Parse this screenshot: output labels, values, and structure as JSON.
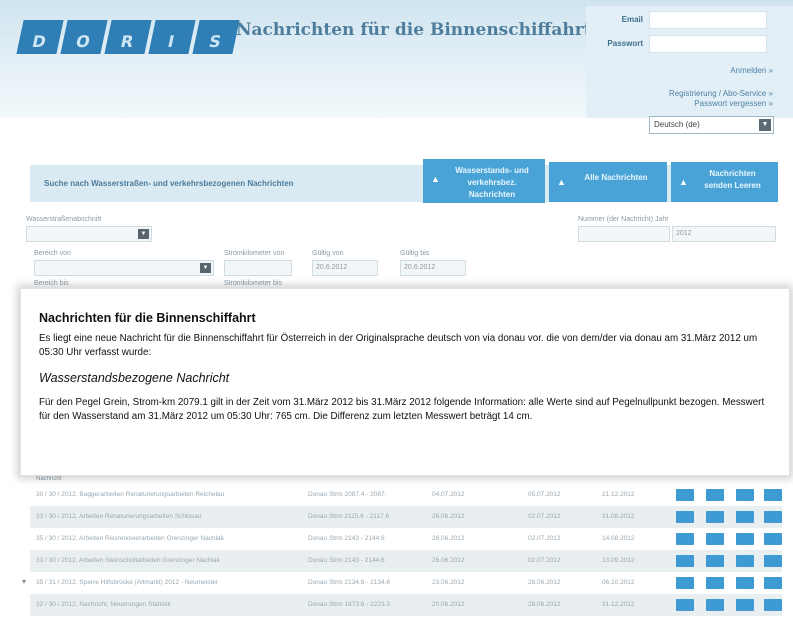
{
  "header": {
    "logo_letters": [
      "D",
      "O",
      "R",
      "I",
      "S"
    ],
    "title": "Nachrichten für die Binnenschiffahrt",
    "login": {
      "email_label": "Email",
      "password_label": "Passwort",
      "links": [
        "Anmelden",
        "Registrierung / Abo-Service",
        "Passwort vergessen"
      ]
    },
    "language": "Deutsch (de)"
  },
  "tabs": {
    "search_title": "Suche nach Wasserstraßen- und verkehrsbezogenen Nachrichten",
    "items": [
      {
        "label": "Wasserstands- und verkehrsbez. Nachrichten"
      },
      {
        "label": "Alle Nachrichten"
      },
      {
        "label": "Nachrichten senden Leeren"
      }
    ]
  },
  "form": {
    "waterway_label": "Wasserstraßenabschnitt",
    "range_from_label": "Bereich von",
    "range_to_label": "Bereich bis",
    "km_from_label": "Stromkilometer von",
    "km_to_label": "Stromkilometer bis",
    "valid_from_label": "Gültig von",
    "valid_to_label": "Gültig bis",
    "valid_from_value": "20.6.2012",
    "valid_to_value": "20.6.2012",
    "number_year_label": "Nummer (der Nachricht) Jahr",
    "year_value": "2012"
  },
  "overlay": {
    "title": "Nachrichten für die Binnenschiffahrt",
    "intro": "Es liegt eine neue Nachricht für die Binnenschiffahrt für Österreich in der Originalsprache deutsch von via donau vor. die von dem/der via donau am 31.März 2012 um 05:30 Uhr verfasst wurde:",
    "subtitle": "Wasserstandsbezogene Nachricht",
    "body": "Für den Pegel Grein, Strom-km 2079.1 gilt in der Zeit vom 31.März 2012 bis 31.März 2012 folgende Information: alle Werte sind auf Pegelnullpunkt bezogen. Messwert für den Wasserstand am 31.März 2012 um 05:30 Uhr: 765 cm. Die Differenz zum letzten Messwert beträgt 14 cm."
  },
  "results": {
    "header_label": "Nachricht",
    "rows": [
      {
        "title": "30 / 30 / 2012, Baggerarbeiten Renaturierungsarbeiten Reichelau",
        "km": "Donau Strm 2087.4 - 2087.",
        "from": "04.07.2012",
        "to": "05.07.2012",
        "date": "21.12.2012"
      },
      {
        "title": "33 / 30 / 2012, Arbeiten Renaturierungsarbeiten Schlosau",
        "km": "Donau Strm 2115.6 - 2117.6",
        "from": "26.06.2012",
        "to": "02.07.2012",
        "date": "31.08.2012"
      },
      {
        "title": "35 / 30 / 2012, Arbeiten Rissrenovierarbeiten Grenzinger Nachlak",
        "km": "Donau Strm 2143 - 2144.6",
        "from": "26.06.2012",
        "to": "02.07.2012",
        "date": "14.08.2012"
      },
      {
        "title": "33 / 30 / 2012, Arbeiten Steinschüttarbeiten Grenzinger Nachlak",
        "km": "Donau Strm 2143 - 2144.6",
        "from": "26.06.2012",
        "to": "02.07.2012",
        "date": "13.09.2012"
      },
      {
        "title": "35 / 31 / 2012, Sperre Hilfsbrücke (Altmarkt) 2012 - Neumeister",
        "km": "Donau Strm 2134.6 - 2134.6",
        "from": "23.06.2012",
        "to": "28.06.2012",
        "date": "06.10.2012"
      },
      {
        "title": "32 / 30 / 2012, Nachricht, Neuerungen Statistik",
        "km": "Donau Strm 1873.6 - 2223.3",
        "from": "20.06.2012",
        "to": "28.06.2012",
        "date": "31.12.2012"
      }
    ]
  }
}
